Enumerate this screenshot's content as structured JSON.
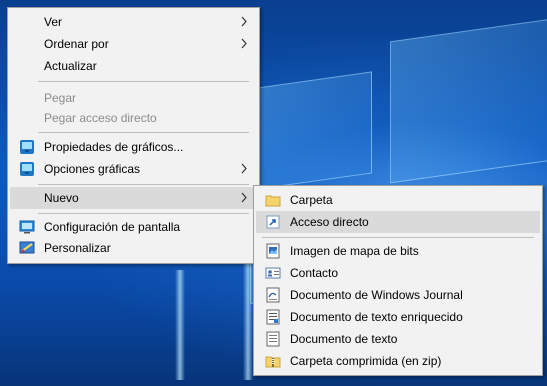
{
  "context_menu": {
    "items": [
      {
        "label": "Ver"
      },
      {
        "label": "Ordenar por"
      },
      {
        "label": "Actualizar"
      },
      {
        "label": "Pegar"
      },
      {
        "label": "Pegar acceso directo"
      },
      {
        "label": "Propiedades de gráficos..."
      },
      {
        "label": "Opciones gráficas"
      },
      {
        "label": "Nuevo"
      },
      {
        "label": "Configuración de pantalla"
      },
      {
        "label": "Personalizar"
      }
    ]
  },
  "new_submenu": {
    "items": [
      {
        "label": "Carpeta"
      },
      {
        "label": "Acceso directo"
      },
      {
        "label": "Imagen de mapa de bits"
      },
      {
        "label": "Contacto"
      },
      {
        "label": "Documento de Windows Journal"
      },
      {
        "label": "Documento de texto enriquecido"
      },
      {
        "label": "Documento de texto"
      },
      {
        "label": "Carpeta comprimida (en zip)"
      }
    ]
  },
  "colors": {
    "menu_bg": "#f2f2f2",
    "hover_bg": "#dadada",
    "disabled_text": "#8c8c8c",
    "desktop_blue": "#0c5bc1"
  }
}
